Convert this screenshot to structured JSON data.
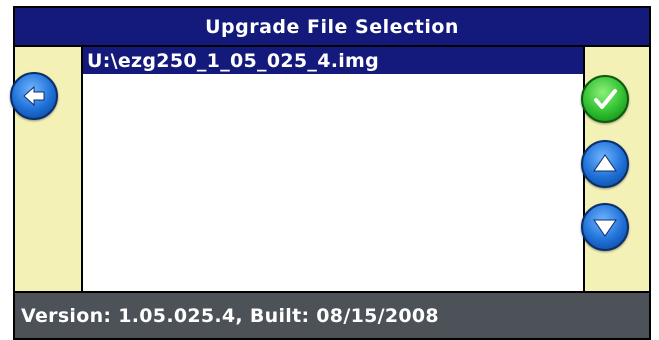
{
  "window": {
    "title": "Upgrade File Selection"
  },
  "file_list": {
    "items": [
      {
        "label": "U:\\ezg250_1_05_025_4.img",
        "selected": true
      }
    ]
  },
  "status": {
    "text": "Version: 1.05.025.4, Built: 08/15/2008"
  },
  "buttons": {
    "back": {
      "icon": "arrow-left-icon"
    },
    "confirm": {
      "icon": "checkmark-icon"
    },
    "scroll_up": {
      "icon": "arrow-up-icon"
    },
    "scroll_down": {
      "icon": "arrow-down-icon"
    }
  },
  "colors": {
    "title_bar": "#141a7c",
    "side_panel": "#f4f1b7",
    "status_bar": "#4d5158",
    "button_blue": "#1e6fd6",
    "button_green": "#2fbf2f"
  }
}
